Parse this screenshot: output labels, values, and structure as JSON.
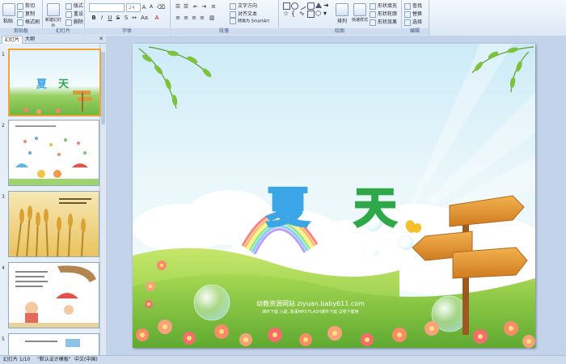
{
  "ribbon": {
    "clipboard": {
      "group_label": "剪贴板",
      "paste_label": "粘贴",
      "cut_label": "剪切",
      "copy_label": "复制",
      "format_painter_label": "格式刷"
    },
    "slides": {
      "group_label": "幻灯片",
      "new_slide_label": "新建幻灯片",
      "layout_label": "版式",
      "reset_label": "重设",
      "delete_label": "删除"
    },
    "font": {
      "group_label": "字体",
      "size_value": "24"
    },
    "paragraph": {
      "group_label": "段落",
      "text_direction_label": "文字方向",
      "align_text_label": "对齐文本",
      "smartart_label": "转换为 SmartArt"
    },
    "drawing": {
      "group_label": "绘图",
      "arrange_label": "排列",
      "quick_styles_label": "快速样式",
      "fill_label": "形状填充",
      "outline_label": "形状轮廓",
      "effects_label": "形状效果"
    },
    "editing": {
      "group_label": "编辑",
      "find_label": "查找",
      "replace_label": "替换",
      "select_label": "选择"
    }
  },
  "panel": {
    "tab_slides": "幻灯片",
    "tab_outline": "大纲",
    "close_icon": "close-icon",
    "slide_numbers": [
      "1",
      "2",
      "3",
      "4",
      "5"
    ]
  },
  "slide": {
    "title_char1": "夏",
    "title_char2": "天",
    "title_char1_color": "#3aa6e8",
    "title_char2_color": "#2fa84a",
    "watermark_line1": "幼教资源网站  ziyuan.baby611.com",
    "watermark_line2": "课件下载  儿歌, 故事MP3  FLASH课件下载  试卷下载等"
  },
  "status": {
    "slide_count": "幻灯片 1/10",
    "theme": "\"默认设计模板\"",
    "language": "中文(中国)"
  }
}
